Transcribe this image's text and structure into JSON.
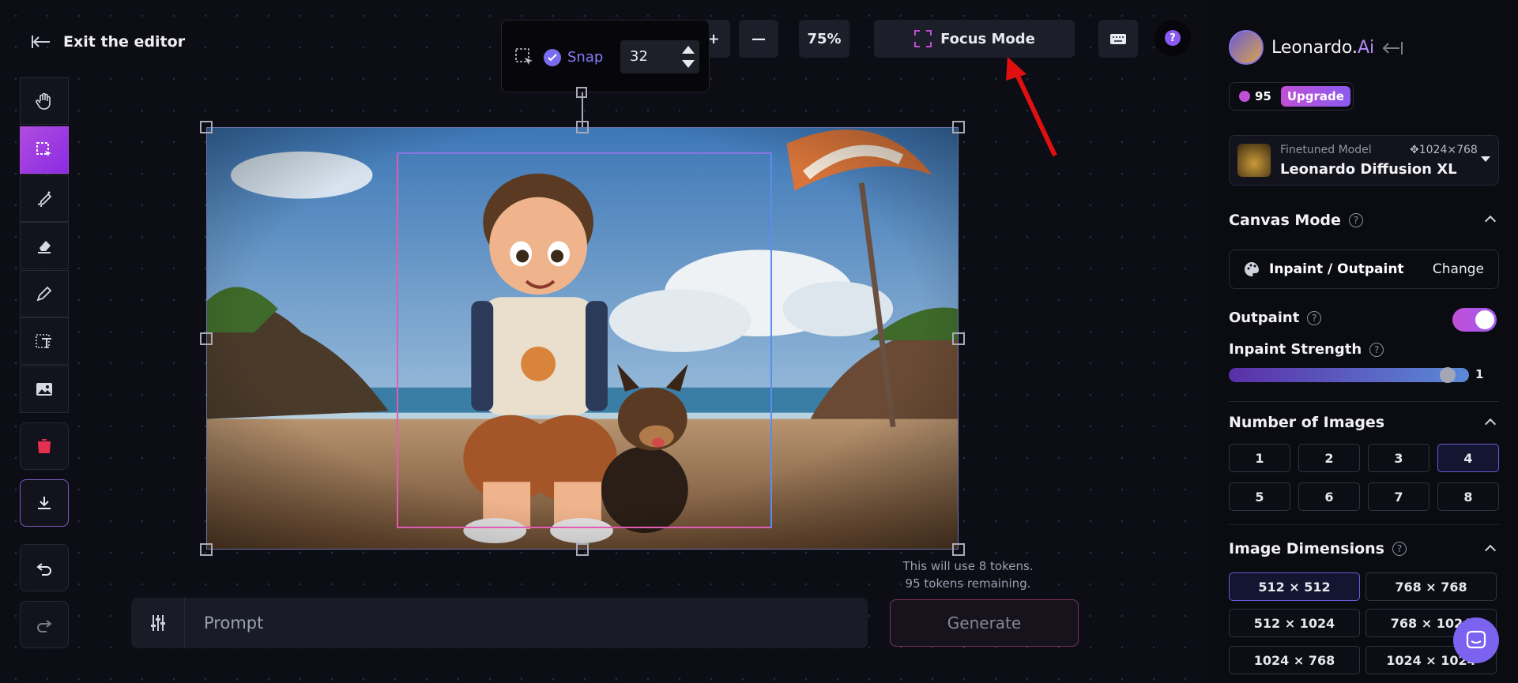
{
  "header": {
    "exit_label": "Exit the editor"
  },
  "toolbar": {
    "zoom_level": "75%",
    "focus_mode_label": "Focus Mode",
    "snap_label": "Snap",
    "snap_value": "32"
  },
  "canvas": {
    "tokens_use": "This will use 8 tokens.",
    "tokens_remaining": "95 tokens remaining."
  },
  "prompt": {
    "placeholder": "Prompt",
    "generate_label": "Generate"
  },
  "sidebar": {
    "brand_main": "Leonardo.",
    "brand_ai": "Ai",
    "token_count": "95",
    "upgrade_label": "Upgrade",
    "model_type": "Finetuned Model",
    "model_dims": "1024×768",
    "model_name": "Leonardo Diffusion XL",
    "canvas_mode_title": "Canvas Mode",
    "canvas_mode_value": "Inpaint / Outpaint",
    "change_label": "Change",
    "outpaint_label": "Outpaint",
    "outpaint_enabled": true,
    "inpaint_strength_label": "Inpaint Strength",
    "inpaint_strength_value": "1",
    "num_images_title": "Number of Images",
    "num_images_options": [
      "1",
      "2",
      "3",
      "4",
      "5",
      "6",
      "7",
      "8"
    ],
    "num_images_selected": "4",
    "dimensions_title": "Image Dimensions",
    "dimension_options": [
      "512 × 512",
      "768 × 768",
      "512 × 1024",
      "768 × 1024",
      "1024 × 768",
      "1024 × 1024"
    ],
    "dimension_selected": "512 × 512"
  },
  "colors": {
    "accent": "#b04ce0",
    "annotation_arrow": "#e01010"
  }
}
